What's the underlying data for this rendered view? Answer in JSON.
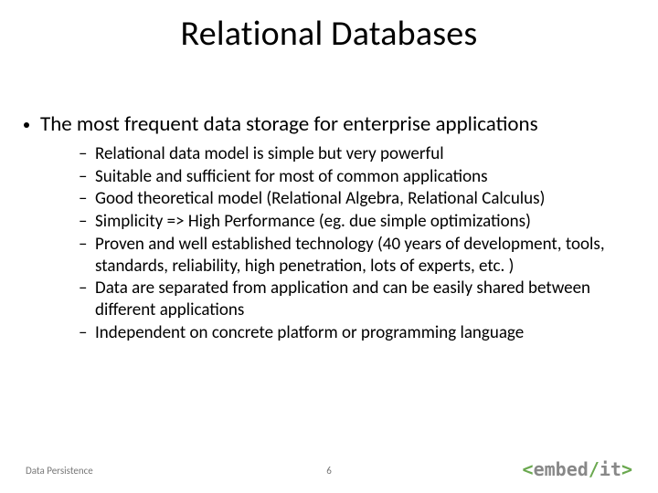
{
  "title": "Relational Databases",
  "main_bullet": "The most frequent data storage for enterprise applications",
  "sub_bullets": [
    "Relational data model is simple but very powerful",
    "Suitable and sufficient for most of common applications",
    "Good theoretical model (Relational Algebra, Relational Calculus)",
    "Simplicity => High Performance (eg. due simple optimizations)",
    "Proven and well established technology (40 years of development, tools, standards, reliability, high penetration, lots of experts, etc. )",
    "Data are separated from application and can be easily shared between different applications",
    "Independent on concrete platform or programming language"
  ],
  "footer_left": "Data Persistence",
  "page_number": "6",
  "logo": {
    "lt": "<",
    "name": "embed",
    "slash": "/",
    "it": "it",
    "gt": ">"
  }
}
